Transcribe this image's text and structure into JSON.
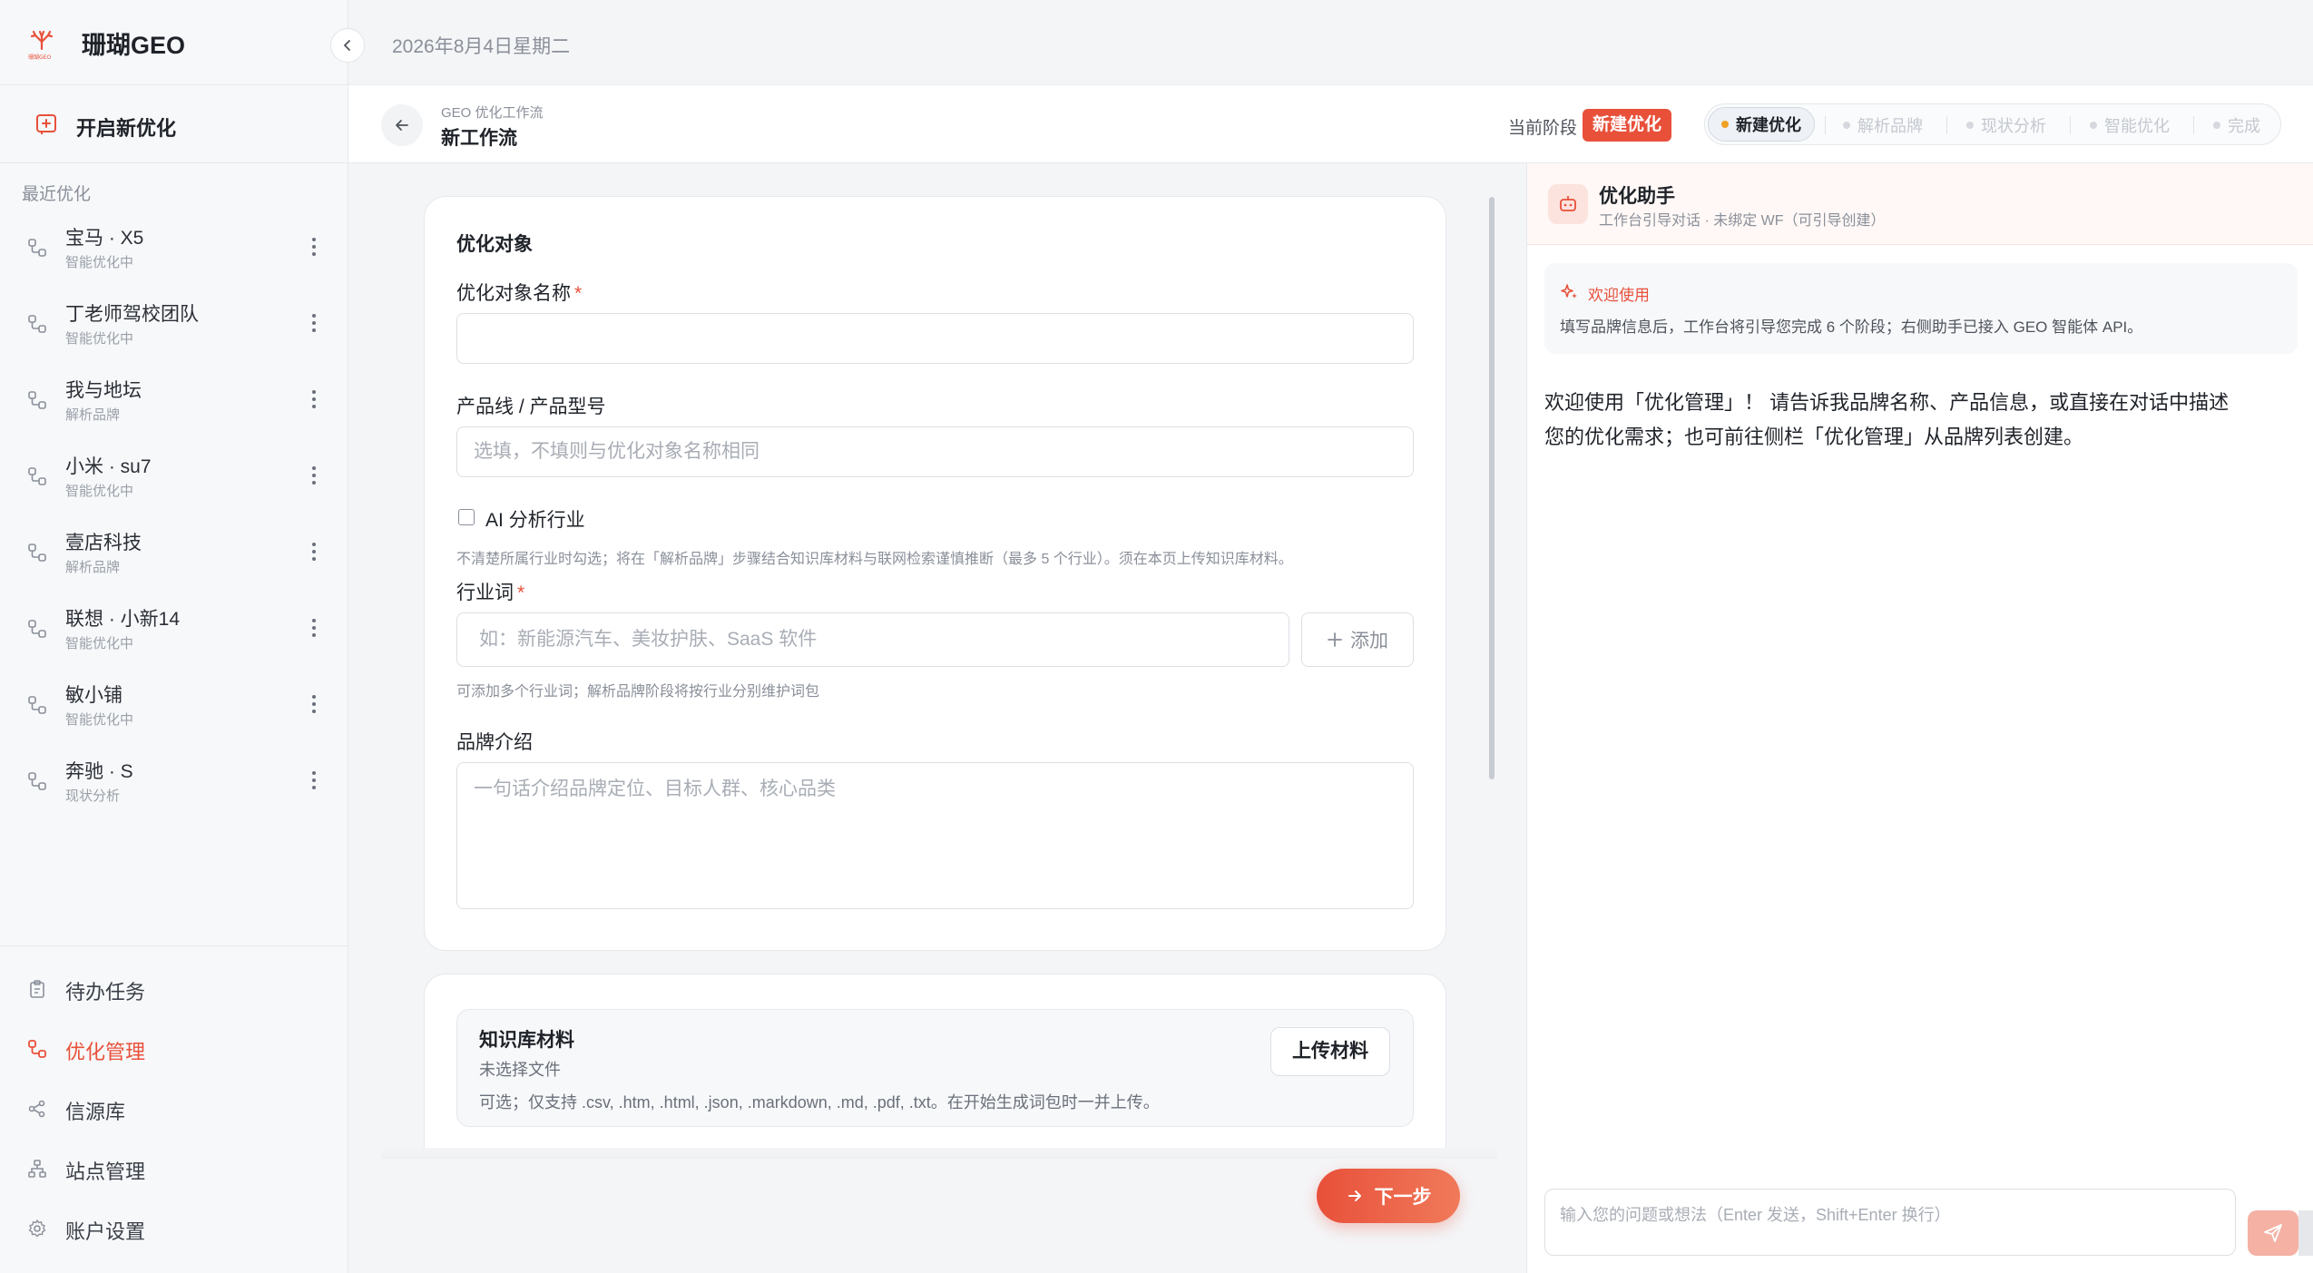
{
  "app": {
    "name": "珊瑚GEO",
    "logo_text": "珊瑚GEO"
  },
  "sidebar": {
    "new_optimization": "开启新优化",
    "recent_title": "最近优化",
    "recent": [
      {
        "name": "宝马 · X5",
        "status": "智能优化中"
      },
      {
        "name": "丁老师驾校团队",
        "status": "智能优化中"
      },
      {
        "name": "我与地坛",
        "status": "解析品牌"
      },
      {
        "name": "小米 · su7",
        "status": "智能优化中"
      },
      {
        "name": "壹店科技",
        "status": "解析品牌"
      },
      {
        "name": "联想 · 小新14",
        "status": "智能优化中"
      },
      {
        "name": "敏小铺",
        "status": "智能优化中"
      },
      {
        "name": "奔驰 · S",
        "status": "现状分析"
      }
    ],
    "nav": [
      {
        "label": "待办任务",
        "icon": "clipboard-icon",
        "active": false
      },
      {
        "label": "优化管理",
        "icon": "workflow-icon",
        "active": true
      },
      {
        "label": "信源库",
        "icon": "share-nodes-icon",
        "active": false
      },
      {
        "label": "站点管理",
        "icon": "sitemap-icon",
        "active": false
      },
      {
        "label": "账户设置",
        "icon": "gear-icon",
        "active": false
      }
    ]
  },
  "topbar": {
    "date": "2026年8月4日星期二"
  },
  "workflow": {
    "subtitle": "GEO 优化工作流",
    "title": "新工作流",
    "stage_label": "当前阶段",
    "stage_badge": "新建优化",
    "steps": [
      "新建优化",
      "解析品牌",
      "现状分析",
      "智能优化",
      "完成"
    ]
  },
  "form": {
    "section_title": "优化对象",
    "name_label": "优化对象名称",
    "name_value": "",
    "product_label": "产品线 / 产品型号",
    "product_placeholder": "选填，不填则与优化对象名称相同",
    "ai_checkbox_label": "AI 分析行业",
    "ai_hint": "不清楚所属行业时勾选；将在「解析品牌」步骤结合知识库材料与联网检索谨慎推断（最多 5 个行业）。须在本页上传知识库材料。",
    "industry_label": "行业词",
    "industry_placeholder": "如：新能源汽车、美妆护肤、SaaS 软件",
    "add_label": "添加",
    "industry_hint": "可添加多个行业词；解析品牌阶段将按行业分别维护词包",
    "intro_label": "品牌介绍",
    "intro_placeholder": "一句话介绍品牌定位、目标人群、核心品类",
    "kb_title": "知识库材料",
    "kb_status": "未选择文件",
    "kb_desc": "可选；仅支持 .csv, .htm, .html, .json, .markdown, .md, .pdf, .txt。在开始生成词包时一并上传。",
    "upload_label": "上传材料",
    "next_label": "下一步"
  },
  "assistant": {
    "title": "优化助手",
    "subtitle": "工作台引导对话 · 未绑定 WF（可引导创建）",
    "welcome_title": "欢迎使用",
    "welcome_desc": "填写品牌信息后，工作台将引导您完成 6 个阶段；右侧助手已接入 GEO 智能体 API。",
    "message": "欢迎使用「优化管理」！ 请告诉我品牌名称、产品信息，或直接在对话中描述您的优化需求；也可前往侧栏「优化管理」从品牌列表创建。",
    "input_placeholder": "输入您的问题或想法（Enter 发送，Shift+Enter 换行）"
  },
  "colors": {
    "accent": "#e8503a",
    "step_active_dot": "#f0a020"
  }
}
